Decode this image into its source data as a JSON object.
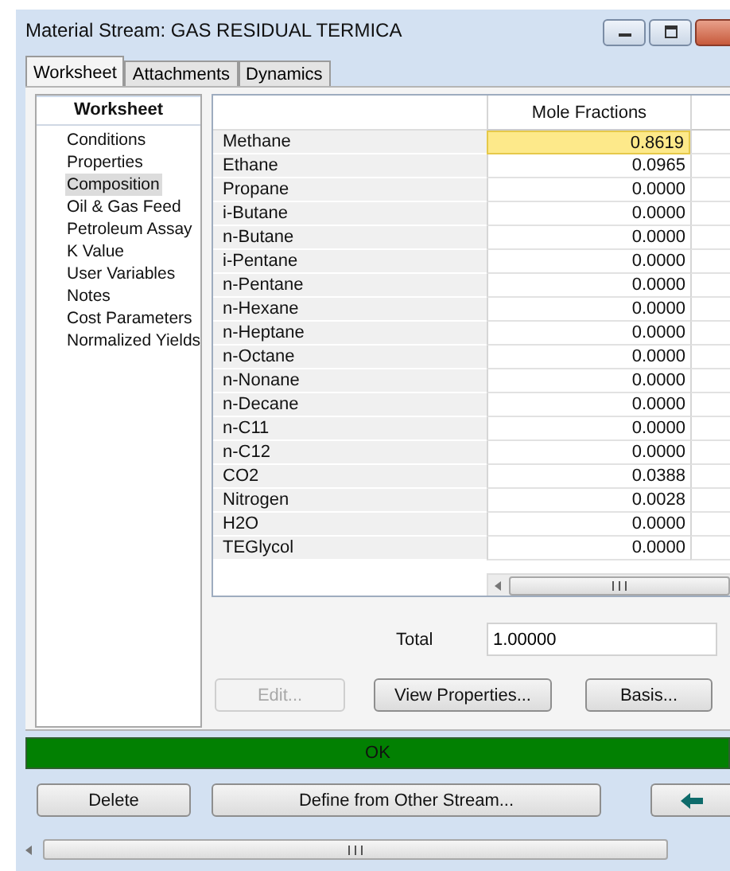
{
  "window": {
    "title": "Material Stream: GAS RESIDUAL TERMICA"
  },
  "tabs": [
    {
      "label": "Worksheet",
      "selected": true
    },
    {
      "label": "Attachments",
      "selected": false
    },
    {
      "label": "Dynamics",
      "selected": false
    }
  ],
  "sidebar": {
    "header": "Worksheet",
    "items": [
      {
        "label": "Conditions",
        "selected": false
      },
      {
        "label": "Properties",
        "selected": false
      },
      {
        "label": "Composition",
        "selected": true
      },
      {
        "label": "Oil & Gas Feed",
        "selected": false
      },
      {
        "label": "Petroleum Assay",
        "selected": false
      },
      {
        "label": "K Value",
        "selected": false
      },
      {
        "label": "User Variables",
        "selected": false
      },
      {
        "label": "Notes",
        "selected": false
      },
      {
        "label": "Cost Parameters",
        "selected": false
      },
      {
        "label": "Normalized Yields",
        "selected": false
      }
    ]
  },
  "table": {
    "columns": [
      "Mole Fractions"
    ],
    "rows": [
      {
        "name": "Methane",
        "value": "0.8619",
        "selected": true
      },
      {
        "name": "Ethane",
        "value": "0.0965",
        "selected": false
      },
      {
        "name": "Propane",
        "value": "0.0000",
        "selected": false
      },
      {
        "name": "i-Butane",
        "value": "0.0000",
        "selected": false
      },
      {
        "name": "n-Butane",
        "value": "0.0000",
        "selected": false
      },
      {
        "name": "i-Pentane",
        "value": "0.0000",
        "selected": false
      },
      {
        "name": "n-Pentane",
        "value": "0.0000",
        "selected": false
      },
      {
        "name": "n-Hexane",
        "value": "0.0000",
        "selected": false
      },
      {
        "name": "n-Heptane",
        "value": "0.0000",
        "selected": false
      },
      {
        "name": "n-Octane",
        "value": "0.0000",
        "selected": false
      },
      {
        "name": "n-Nonane",
        "value": "0.0000",
        "selected": false
      },
      {
        "name": "n-Decane",
        "value": "0.0000",
        "selected": false
      },
      {
        "name": "n-C11",
        "value": "0.0000",
        "selected": false
      },
      {
        "name": "n-C12",
        "value": "0.0000",
        "selected": false
      },
      {
        "name": "CO2",
        "value": "0.0388",
        "selected": false
      },
      {
        "name": "Nitrogen",
        "value": "0.0028",
        "selected": false
      },
      {
        "name": "H2O",
        "value": "0.0000",
        "selected": false
      },
      {
        "name": "TEGlycol",
        "value": "0.0000",
        "selected": false
      }
    ]
  },
  "total": {
    "label": "Total",
    "value": "1.00000"
  },
  "actions": [
    {
      "label": "Edit...",
      "disabled": true
    },
    {
      "label": "View Properties...",
      "disabled": false
    },
    {
      "label": "Basis...",
      "disabled": false
    }
  ],
  "status_bar": {
    "text": "OK"
  },
  "footer_buttons": [
    {
      "label": "Delete",
      "kind": "text"
    },
    {
      "label": "Define from Other Stream...",
      "kind": "text"
    },
    {
      "kind": "arrow"
    }
  ]
}
